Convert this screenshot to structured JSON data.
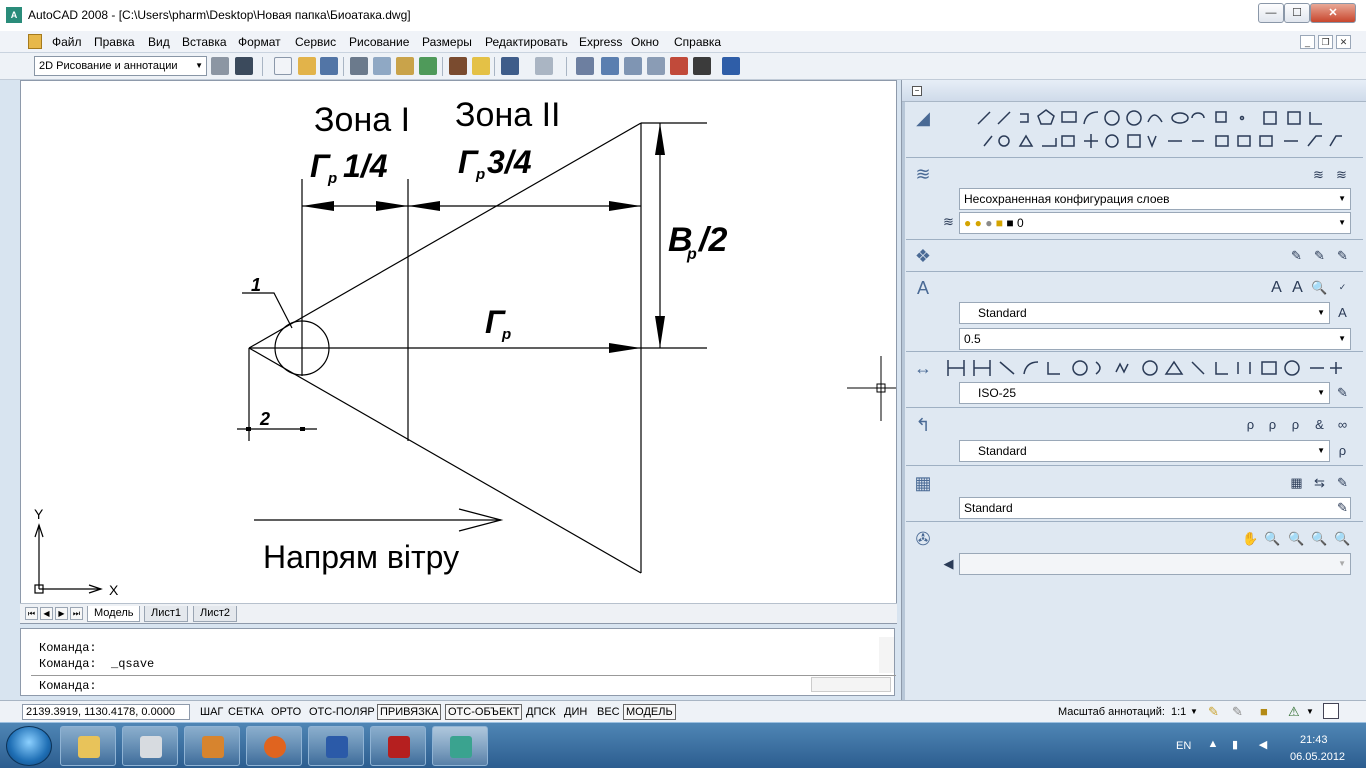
{
  "window": {
    "title": "AutoCAD 2008 - [C:\\Users\\pharm\\Desktop\\Новая папка\\Биоатака.dwg]",
    "controls": {
      "minimize": "—",
      "maximize": "☐",
      "close": "✕"
    }
  },
  "menu": {
    "items": [
      "Файл",
      "Правка",
      "Вид",
      "Вставка",
      "Формат",
      "Сервис",
      "Рисование",
      "Размеры",
      "Редактировать",
      "Express",
      "Окно",
      "Справка"
    ],
    "mdi": {
      "minimize": "_",
      "restore": "❐",
      "close": "✕"
    }
  },
  "toolbar": {
    "workspace": "2D Рисование и аннотации"
  },
  "drawing": {
    "zone1": "Зона I",
    "zone2": "Зона II",
    "gp_base": "Г",
    "gp_sub": "р",
    "gp_quarter": "1/4",
    "gp_three_quarters": "3/4",
    "bp_base": "В",
    "bp_sub": "р",
    "bp_half": "/2",
    "label_1": "1",
    "label_2": "2",
    "wind": "Напрям вітру",
    "ucs_x": "X",
    "ucs_y": "Y"
  },
  "layout_tabs": [
    "Модель",
    "Лист1",
    "Лист2"
  ],
  "command": {
    "history": [
      "Команда:",
      "Команда:  _qsave"
    ],
    "prompt": "Команда:"
  },
  "palette": {
    "layer_state": "Несохраненная конфигурация слоев",
    "current_layer": "0",
    "text_style": "Standard",
    "text_height": "0.5",
    "dim_style": "ISO-25",
    "mleader_style": "Standard",
    "table_style": "Standard"
  },
  "status": {
    "coords": "2139.3919, 1130.4178, 0.0000",
    "toggles": [
      "ШАГ",
      "СЕТКА",
      "ОРТО",
      "ОТС-ПОЛЯР",
      "ПРИВЯЗКА",
      "ОТС-ОБЪЕКТ",
      "ДПСК",
      "ДИН",
      "ВЕС",
      "МОДЕЛЬ"
    ],
    "annotation_scale_label": "Масштаб аннотаций:",
    "annotation_scale_value": "1:1"
  },
  "taskbar": {
    "lang": "EN",
    "time": "21:43",
    "date": "06.05.2012"
  }
}
